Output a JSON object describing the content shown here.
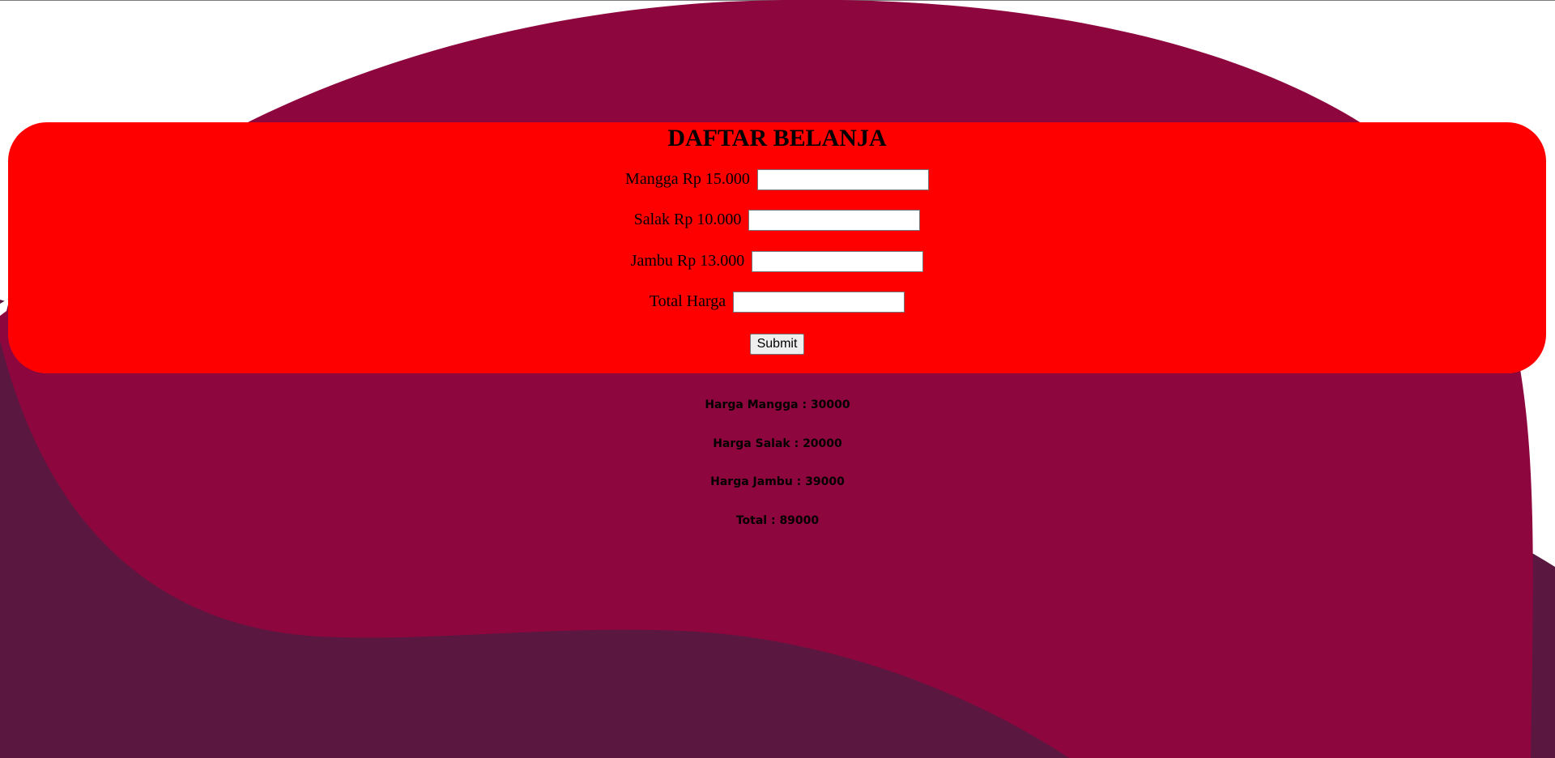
{
  "form": {
    "title": "DAFTAR BELANJA",
    "fields": [
      {
        "label": "Mangga Rp 15.000",
        "value": ""
      },
      {
        "label": "Salak Rp 10.000",
        "value": ""
      },
      {
        "label": "Jambu Rp 13.000",
        "value": ""
      },
      {
        "label": "Total Harga",
        "value": ""
      }
    ],
    "submit_label": "Submit"
  },
  "results": {
    "mangga": "Harga Mangga : 30000",
    "salak": "Harga Salak : 20000",
    "jambu": "Harga Jambu : 39000",
    "total": "Total : 89000"
  },
  "colors": {
    "card_background": "#ff0000",
    "wave_front": "#8e063e",
    "wave_back": "#5a1841",
    "page_background": "#ffffff"
  }
}
